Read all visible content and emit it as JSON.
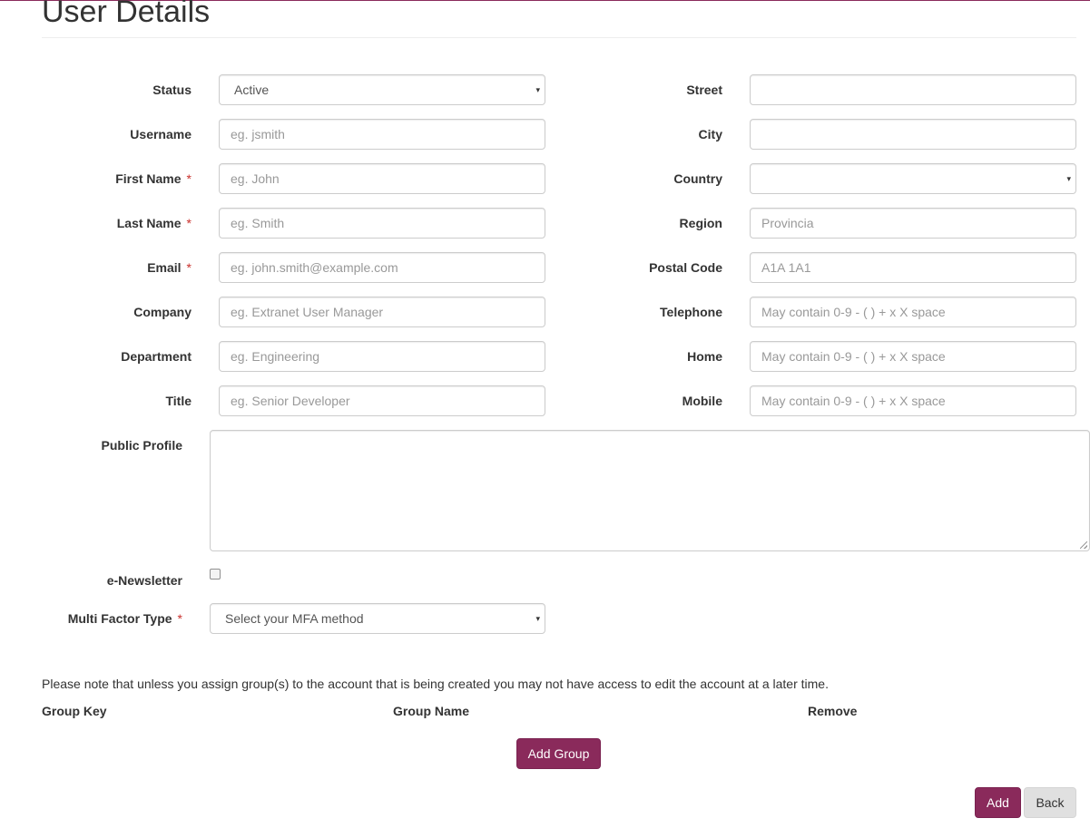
{
  "page": {
    "title": "User Details",
    "accent_color": "#8a2a5b",
    "required_color": "#c9302c"
  },
  "form": {
    "required_marker": "*",
    "status": {
      "label": "Status",
      "value": "Active",
      "caret": "▾"
    },
    "username": {
      "label": "Username",
      "placeholder": "eg. jsmith"
    },
    "first_name": {
      "label": "First Name",
      "placeholder": "eg. John"
    },
    "last_name": {
      "label": "Last Name",
      "placeholder": "eg. Smith"
    },
    "email": {
      "label": "Email",
      "placeholder": "eg. john.smith@example.com"
    },
    "company": {
      "label": "Company",
      "placeholder": "eg. Extranet User Manager"
    },
    "department": {
      "label": "Department",
      "placeholder": "eg. Engineering"
    },
    "title": {
      "label": "Title",
      "placeholder": "eg. Senior Developer"
    },
    "street": {
      "label": "Street",
      "placeholder": ""
    },
    "city": {
      "label": "City",
      "placeholder": ""
    },
    "country": {
      "label": "Country",
      "value": "",
      "caret": "▾"
    },
    "region": {
      "label": "Region",
      "placeholder": "Provincia"
    },
    "postal_code": {
      "label": "Postal Code",
      "placeholder": "A1A 1A1"
    },
    "telephone": {
      "label": "Telephone",
      "placeholder": "May contain 0-9 - ( ) + x X space"
    },
    "home": {
      "label": "Home",
      "placeholder": "May contain 0-9 - ( ) + x X space"
    },
    "mobile": {
      "label": "Mobile",
      "placeholder": "May contain 0-9 - ( ) + x X space"
    },
    "public_profile": {
      "label": "Public Profile"
    },
    "e_newsletter": {
      "label": "e-Newsletter",
      "checked": false
    },
    "mfa": {
      "label": "Multi Factor Type",
      "value": "Select your MFA method",
      "caret": "▾"
    }
  },
  "groups": {
    "note": "Please note that unless you assign group(s) to the account that is being created you may not have access to edit the account at a later time.",
    "columns": [
      "Group Key",
      "Group Name",
      "Remove"
    ],
    "add_group_label": "Add Group"
  },
  "actions": {
    "add_label": "Add",
    "back_label": "Back"
  }
}
